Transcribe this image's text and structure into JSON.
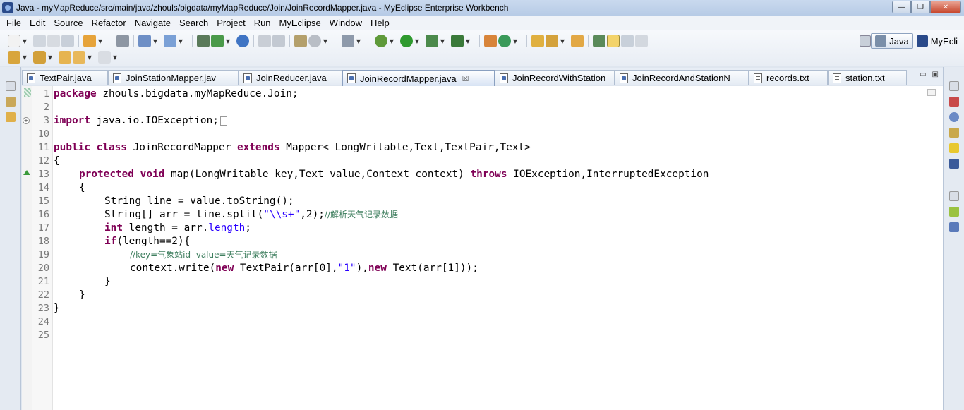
{
  "window": {
    "title": "Java - myMapReduce/src/main/java/zhouls/bigdata/myMapReduce/Join/JoinRecordMapper.java - MyEclipse Enterprise Workbench",
    "minimize": "—",
    "maximize": "❐",
    "close": "✕"
  },
  "menu": [
    "File",
    "Edit",
    "Source",
    "Refactor",
    "Navigate",
    "Search",
    "Project",
    "Run",
    "MyEclipse",
    "Window",
    "Help"
  ],
  "perspectives": [
    {
      "label": "Java",
      "active": true
    },
    {
      "label": "MyEcli",
      "active": false
    }
  ],
  "tabs": [
    {
      "label": "TextPair.java",
      "type": "java",
      "active": false
    },
    {
      "label": "JoinStationMapper.jav",
      "type": "java",
      "active": false
    },
    {
      "label": "JoinReducer.java",
      "type": "java",
      "active": false
    },
    {
      "label": "JoinRecordMapper.java",
      "type": "java",
      "active": true,
      "close": "☒"
    },
    {
      "label": "JoinRecordWithStation",
      "type": "java",
      "active": false
    },
    {
      "label": "JoinRecordAndStationN",
      "type": "java",
      "active": false
    },
    {
      "label": "records.txt",
      "type": "txt",
      "active": false
    },
    {
      "label": "station.txt",
      "type": "txt",
      "active": false
    }
  ],
  "editor": {
    "line_numbers": [
      "1",
      "2",
      "3",
      "10",
      "11",
      "12",
      "13",
      "14",
      "15",
      "16",
      "17",
      "18",
      "19",
      "20",
      "21",
      "22",
      "23",
      "24",
      "25"
    ],
    "code": {
      "l1_kw": "package",
      "l1_rest": " zhouls.bigdata.myMapReduce.Join;",
      "l3_kw": "import",
      "l3_rest": " java.io.IOException;",
      "l11_kw1": "public",
      "l11_kw2": "class",
      "l11_mid": " JoinRecordMapper ",
      "l11_kw3": "extends",
      "l11_rest": " Mapper< LongWritable,Text,TextPair,Text>",
      "l12": "{",
      "l13_kw1": "protected",
      "l13_kw2": "void",
      "l13_mid": " map(LongWritable key,Text value,Context context) ",
      "l13_kw3": "throws",
      "l13_rest": " IOException,InterruptedException",
      "l14": "{",
      "l15": "String line = value.toString();",
      "l16_pre": "String[] arr = line.split(",
      "l16_str": "\"\\\\s+\"",
      "l16_post": ",2);",
      "l16_cmt": "//解析天气记录数据",
      "l17_kw": "int",
      "l17_rest": " length = arr.",
      "l17_field": "length",
      "l17_end": ";",
      "l18_kw": "if",
      "l18_rest": "(length==2){",
      "l19_cmt_a": "//key=气象站id  value=天气记录数据",
      "l20_pre": "context.write(",
      "l20_kw1": "new",
      "l20_mid1": " TextPair(arr[0],",
      "l20_str": "\"1\"",
      "l20_mid2": "),",
      "l20_kw2": "new",
      "l20_rest": " Text(arr[1]));",
      "l21": "}",
      "l22": "}",
      "l23": "}"
    }
  }
}
